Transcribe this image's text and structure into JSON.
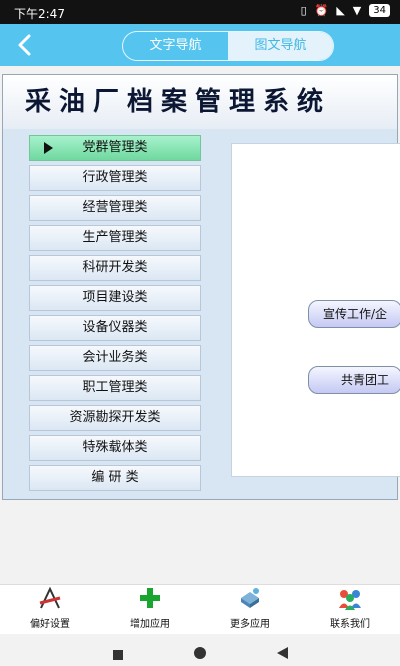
{
  "status_bar": {
    "time": "下午2:47",
    "battery": "34"
  },
  "top_nav": {
    "tabs": [
      "文字导航",
      "图文导航"
    ],
    "active_tab": 1
  },
  "system": {
    "title": "采油厂档案管理系统",
    "categories": [
      "党群管理类",
      "行政管理类",
      "经营管理类",
      "生产管理类",
      "科研开发类",
      "项目建设类",
      "设备仪器类",
      "会计业务类",
      "职工管理类",
      "资源勘探开发类",
      "特殊载体类",
      "编 研 类"
    ],
    "active_category": 0,
    "sub_items": [
      "宣传工作/企",
      "共青团工"
    ]
  },
  "bottom_bar": [
    {
      "label": "偏好设置",
      "icon": "preferences-icon"
    },
    {
      "label": "增加应用",
      "icon": "add-app-icon"
    },
    {
      "label": "更多应用",
      "icon": "more-apps-icon"
    },
    {
      "label": "联系我们",
      "icon": "contact-us-icon"
    }
  ],
  "colors": {
    "appbar": "#55c4ef",
    "active_nav": "#7fe0aa",
    "pill": "#c5c9f3"
  }
}
